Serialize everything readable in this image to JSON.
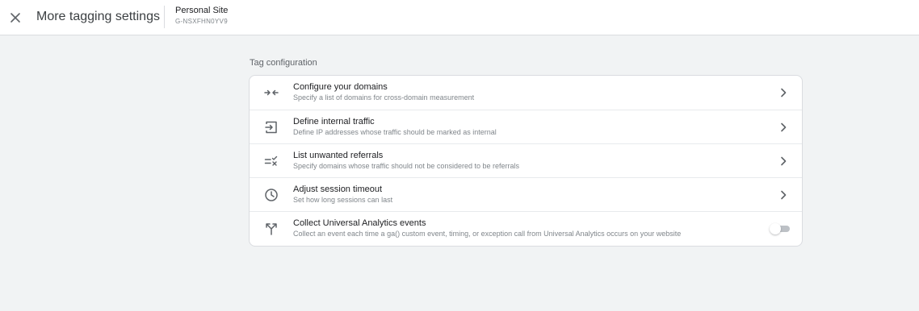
{
  "header": {
    "close_icon": "close-icon",
    "title": "More tagging settings",
    "property_name": "Personal Site",
    "property_id": "G-NSXFHN0YV9"
  },
  "section": {
    "label": "Tag configuration"
  },
  "settings": [
    {
      "title": "Configure your domains",
      "description": "Specify a list of domains for cross-domain measurement",
      "icon": "merge-arrows-icon",
      "control": "chevron"
    },
    {
      "title": "Define internal traffic",
      "description": "Define IP addresses whose traffic should be marked as internal",
      "icon": "login-arrow-icon",
      "control": "chevron"
    },
    {
      "title": "List unwanted referrals",
      "description": "Specify domains whose traffic should not be considered to be referrals",
      "icon": "rule-list-icon",
      "control": "chevron"
    },
    {
      "title": "Adjust session timeout",
      "description": "Set how long sessions can last",
      "icon": "clock-icon",
      "control": "chevron"
    },
    {
      "title": "Collect Universal Analytics events",
      "description": "Collect an event each time a ga() custom event, timing, or exception call from Universal Analytics occurs on your website",
      "icon": "fork-arrows-icon",
      "control": "toggle",
      "toggle_on": false
    }
  ],
  "colors": {
    "background": "#f1f3f4",
    "card": "#ffffff",
    "icon": "#5f6368",
    "toggle_off_track": "#bdc1c6"
  }
}
